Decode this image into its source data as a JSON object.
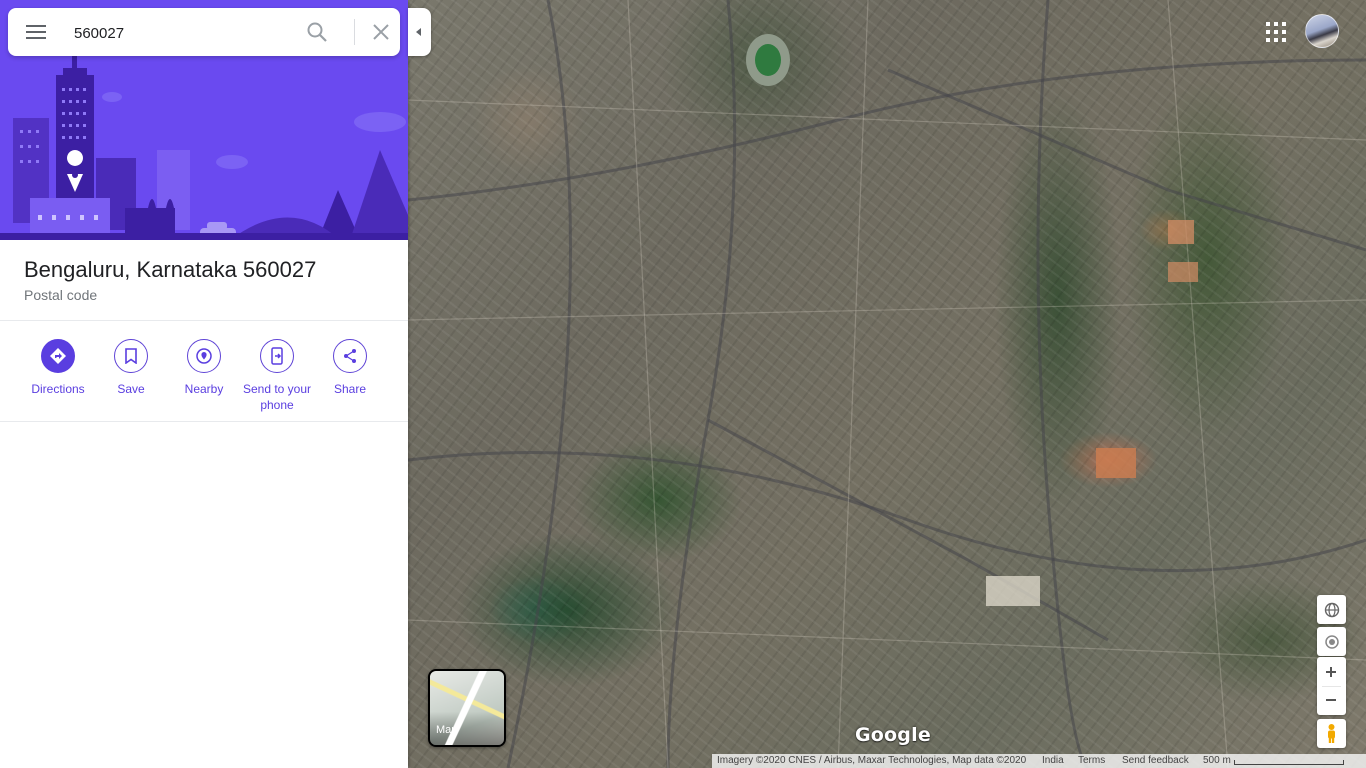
{
  "search": {
    "value": "560027"
  },
  "place": {
    "title": "Bengaluru, Karnataka 560027",
    "subtitle": "Postal code"
  },
  "actions": [
    {
      "label": "Directions",
      "icon": "directions-icon"
    },
    {
      "label": "Save",
      "icon": "bookmark-icon"
    },
    {
      "label": "Nearby",
      "icon": "nearby-icon"
    },
    {
      "label": "Send to your phone",
      "icon": "send-to-phone-icon"
    },
    {
      "label": "Share",
      "icon": "share-icon"
    }
  ],
  "map": {
    "layer_toggle_label": "Map",
    "logo_text": "Google",
    "footer": {
      "attribution": "Imagery ©2020 CNES / Airbus, Maxar Technologies, Map data ©2020",
      "region": "India",
      "terms": "Terms",
      "feedback": "Send feedback",
      "scale": "500 m"
    }
  },
  "colors": {
    "accent": "#5a3ee0",
    "hero_background": "#6a4af0"
  }
}
